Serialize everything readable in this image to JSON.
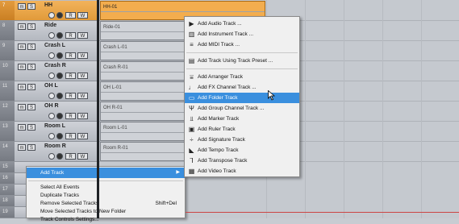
{
  "tracks": [
    {
      "num": "7",
      "name": "HH",
      "event": "HH-01",
      "selected": true
    },
    {
      "num": "8",
      "name": "Ride",
      "event": "Ride-01",
      "selected": false
    },
    {
      "num": "9",
      "name": "Crash L",
      "event": "Crash L-01",
      "selected": false
    },
    {
      "num": "10",
      "name": "Crash R",
      "event": "Crash R-01",
      "selected": false
    },
    {
      "num": "11",
      "name": "OH L",
      "event": "OH L-01",
      "selected": false
    },
    {
      "num": "12",
      "name": "OH R",
      "event": "OH R-01",
      "selected": false
    },
    {
      "num": "13",
      "name": "Room L",
      "event": "Room L-01",
      "selected": false
    },
    {
      "num": "14",
      "name": "Room R",
      "event": "Room R-01",
      "selected": false
    }
  ],
  "track_buttons": {
    "mute": "m",
    "solo": "S",
    "read": "R",
    "write": "W"
  },
  "lower_track_nums": [
    "15",
    "16",
    "17",
    "18",
    "19"
  ],
  "add_track_submenu": [
    {
      "icon": "▶",
      "label": "Add Audio Track ...",
      "icon_name": "audio-track-icon"
    },
    {
      "icon": "▥",
      "label": "Add Instrument Track ...",
      "icon_name": "instrument-track-icon"
    },
    {
      "icon": "≡",
      "label": "Add MIDI Track ...",
      "icon_name": "midi-track-icon"
    },
    {
      "sep": true
    },
    {
      "icon": "▤",
      "label": "Add Track Using Track Preset ...",
      "icon_name": "track-preset-icon"
    },
    {
      "sep": true
    },
    {
      "icon": "⩸",
      "label": "Add Arranger Track",
      "icon_name": "arranger-track-icon"
    },
    {
      "icon": "♩",
      "label": "Add FX Channel Track ...",
      "icon_name": "fx-channel-icon"
    },
    {
      "icon": "▭",
      "label": "Add Folder Track",
      "icon_name": "folder-track-icon",
      "highlight": true
    },
    {
      "icon": "Ψ",
      "label": "Add Group Channel Track ...",
      "icon_name": "group-channel-icon"
    },
    {
      "icon": "⫫",
      "label": "Add Marker Track",
      "icon_name": "marker-track-icon"
    },
    {
      "icon": "▣",
      "label": "Add Ruler Track",
      "icon_name": "ruler-track-icon"
    },
    {
      "icon": "÷",
      "label": "Add Signature Track",
      "icon_name": "signature-track-icon"
    },
    {
      "icon": "◣",
      "label": "Add Tempo Track",
      "icon_name": "tempo-track-icon"
    },
    {
      "icon": "⅂",
      "label": "Add Transpose Track",
      "icon_name": "transpose-track-icon"
    },
    {
      "icon": "▦",
      "label": "Add Video Track",
      "icon_name": "video-track-icon"
    }
  ],
  "context_menu": {
    "add_track": "Add Track",
    "items": [
      {
        "label": "Select All Events",
        "shortcut": ""
      },
      {
        "label": "Duplicate Tracks",
        "shortcut": ""
      },
      {
        "label": "Remove Selected Tracks",
        "shortcut": "Shift+Del"
      },
      {
        "label": "Move Selected Tracks to New Folder",
        "shortcut": ""
      },
      {
        "label": "Track Controls Settings...",
        "shortcut": ""
      }
    ]
  },
  "colors": {
    "selected_track": "#e9a447",
    "menu_highlight": "#3a8fde"
  }
}
